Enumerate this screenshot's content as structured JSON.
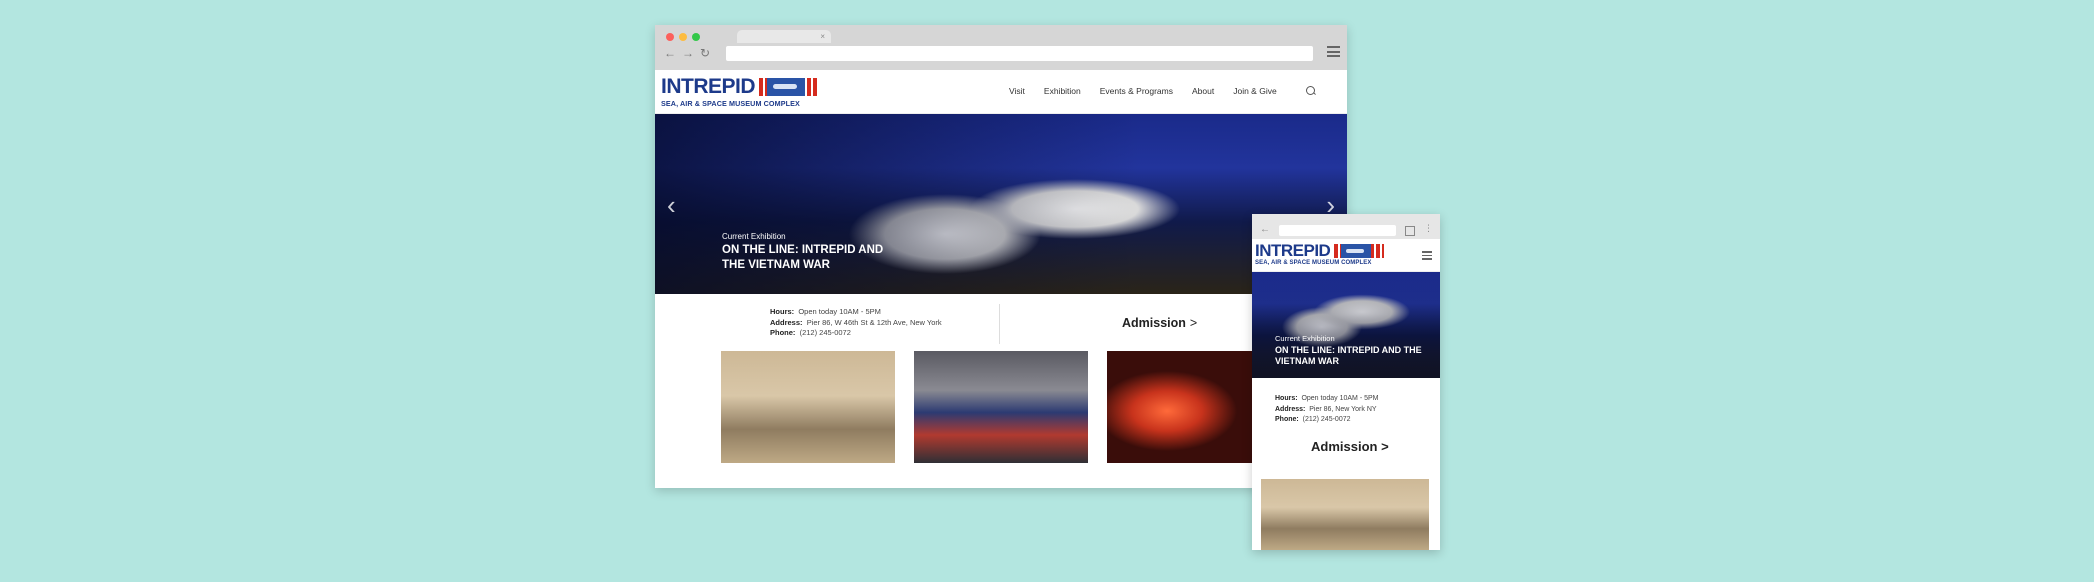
{
  "brand": {
    "logo_text": "INTREPID",
    "logo_subtitle": "SEA, AIR & SPACE MUSEUM COMPLEX"
  },
  "nav": {
    "items": [
      {
        "label": "Visit"
      },
      {
        "label": "Exhibition"
      },
      {
        "label": "Events & Programs"
      },
      {
        "label": "About"
      },
      {
        "label": "Join & Give"
      }
    ]
  },
  "hero": {
    "kicker": "Current Exhibition",
    "title": "ON THE LINE: INTREPID AND THE VIETNAM WAR"
  },
  "info": {
    "hours_label": "Hours:",
    "hours_value": "Open today 10AM - 5PM",
    "address_label": "Address:",
    "address_value": "Pier 86, W 46th St & 12th Ave, New York",
    "phone_label": "Phone:",
    "phone_value": "(212) 245-0072",
    "admission_label": "Admission"
  },
  "mobile": {
    "kicker": "Current Exhibition",
    "title": "ON THE LINE: INTREPID AND THE VIETNAM WAR",
    "address_value": "Pier 86, New York NY"
  },
  "colors": {
    "background": "#b3e6e0",
    "brand_blue": "#1d3a8a",
    "brand_red": "#d52b1e"
  }
}
